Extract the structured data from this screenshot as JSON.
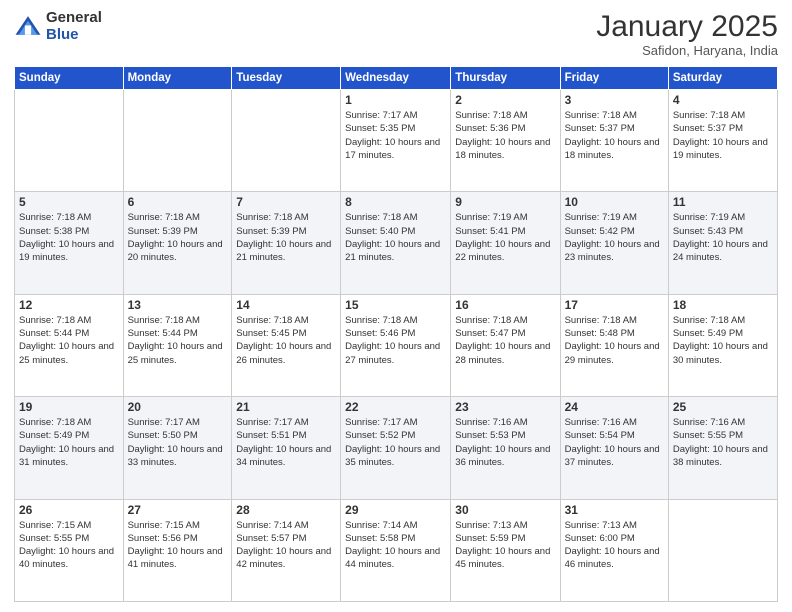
{
  "header": {
    "logo_general": "General",
    "logo_blue": "Blue",
    "month_title": "January 2025",
    "subtitle": "Safidon, Haryana, India"
  },
  "weekdays": [
    "Sunday",
    "Monday",
    "Tuesday",
    "Wednesday",
    "Thursday",
    "Friday",
    "Saturday"
  ],
  "weeks": [
    [
      {
        "day": "",
        "info": ""
      },
      {
        "day": "",
        "info": ""
      },
      {
        "day": "",
        "info": ""
      },
      {
        "day": "1",
        "info": "Sunrise: 7:17 AM\nSunset: 5:35 PM\nDaylight: 10 hours and 17 minutes."
      },
      {
        "day": "2",
        "info": "Sunrise: 7:18 AM\nSunset: 5:36 PM\nDaylight: 10 hours and 18 minutes."
      },
      {
        "day": "3",
        "info": "Sunrise: 7:18 AM\nSunset: 5:37 PM\nDaylight: 10 hours and 18 minutes."
      },
      {
        "day": "4",
        "info": "Sunrise: 7:18 AM\nSunset: 5:37 PM\nDaylight: 10 hours and 19 minutes."
      }
    ],
    [
      {
        "day": "5",
        "info": "Sunrise: 7:18 AM\nSunset: 5:38 PM\nDaylight: 10 hours and 19 minutes."
      },
      {
        "day": "6",
        "info": "Sunrise: 7:18 AM\nSunset: 5:39 PM\nDaylight: 10 hours and 20 minutes."
      },
      {
        "day": "7",
        "info": "Sunrise: 7:18 AM\nSunset: 5:39 PM\nDaylight: 10 hours and 21 minutes."
      },
      {
        "day": "8",
        "info": "Sunrise: 7:18 AM\nSunset: 5:40 PM\nDaylight: 10 hours and 21 minutes."
      },
      {
        "day": "9",
        "info": "Sunrise: 7:19 AM\nSunset: 5:41 PM\nDaylight: 10 hours and 22 minutes."
      },
      {
        "day": "10",
        "info": "Sunrise: 7:19 AM\nSunset: 5:42 PM\nDaylight: 10 hours and 23 minutes."
      },
      {
        "day": "11",
        "info": "Sunrise: 7:19 AM\nSunset: 5:43 PM\nDaylight: 10 hours and 24 minutes."
      }
    ],
    [
      {
        "day": "12",
        "info": "Sunrise: 7:18 AM\nSunset: 5:44 PM\nDaylight: 10 hours and 25 minutes."
      },
      {
        "day": "13",
        "info": "Sunrise: 7:18 AM\nSunset: 5:44 PM\nDaylight: 10 hours and 25 minutes."
      },
      {
        "day": "14",
        "info": "Sunrise: 7:18 AM\nSunset: 5:45 PM\nDaylight: 10 hours and 26 minutes."
      },
      {
        "day": "15",
        "info": "Sunrise: 7:18 AM\nSunset: 5:46 PM\nDaylight: 10 hours and 27 minutes."
      },
      {
        "day": "16",
        "info": "Sunrise: 7:18 AM\nSunset: 5:47 PM\nDaylight: 10 hours and 28 minutes."
      },
      {
        "day": "17",
        "info": "Sunrise: 7:18 AM\nSunset: 5:48 PM\nDaylight: 10 hours and 29 minutes."
      },
      {
        "day": "18",
        "info": "Sunrise: 7:18 AM\nSunset: 5:49 PM\nDaylight: 10 hours and 30 minutes."
      }
    ],
    [
      {
        "day": "19",
        "info": "Sunrise: 7:18 AM\nSunset: 5:49 PM\nDaylight: 10 hours and 31 minutes."
      },
      {
        "day": "20",
        "info": "Sunrise: 7:17 AM\nSunset: 5:50 PM\nDaylight: 10 hours and 33 minutes."
      },
      {
        "day": "21",
        "info": "Sunrise: 7:17 AM\nSunset: 5:51 PM\nDaylight: 10 hours and 34 minutes."
      },
      {
        "day": "22",
        "info": "Sunrise: 7:17 AM\nSunset: 5:52 PM\nDaylight: 10 hours and 35 minutes."
      },
      {
        "day": "23",
        "info": "Sunrise: 7:16 AM\nSunset: 5:53 PM\nDaylight: 10 hours and 36 minutes."
      },
      {
        "day": "24",
        "info": "Sunrise: 7:16 AM\nSunset: 5:54 PM\nDaylight: 10 hours and 37 minutes."
      },
      {
        "day": "25",
        "info": "Sunrise: 7:16 AM\nSunset: 5:55 PM\nDaylight: 10 hours and 38 minutes."
      }
    ],
    [
      {
        "day": "26",
        "info": "Sunrise: 7:15 AM\nSunset: 5:55 PM\nDaylight: 10 hours and 40 minutes."
      },
      {
        "day": "27",
        "info": "Sunrise: 7:15 AM\nSunset: 5:56 PM\nDaylight: 10 hours and 41 minutes."
      },
      {
        "day": "28",
        "info": "Sunrise: 7:14 AM\nSunset: 5:57 PM\nDaylight: 10 hours and 42 minutes."
      },
      {
        "day": "29",
        "info": "Sunrise: 7:14 AM\nSunset: 5:58 PM\nDaylight: 10 hours and 44 minutes."
      },
      {
        "day": "30",
        "info": "Sunrise: 7:13 AM\nSunset: 5:59 PM\nDaylight: 10 hours and 45 minutes."
      },
      {
        "day": "31",
        "info": "Sunrise: 7:13 AM\nSunset: 6:00 PM\nDaylight: 10 hours and 46 minutes."
      },
      {
        "day": "",
        "info": ""
      }
    ]
  ]
}
